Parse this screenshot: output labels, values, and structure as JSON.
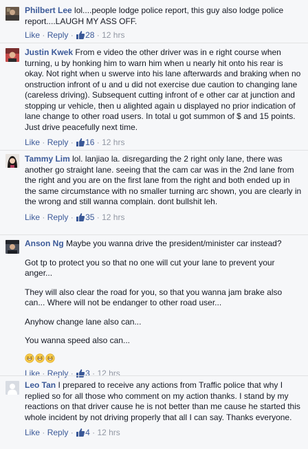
{
  "comments": [
    {
      "name": "Philbert Lee",
      "text": "lol....people lodge police report, this guy also lodge police report....LAUGH MY ASS OFF.",
      "like_label": "Like",
      "reply_label": "Reply",
      "likes": "28",
      "time": "12 hrs"
    },
    {
      "name": "Justin Kwek",
      "text": "From e video the other driver was in e right course when turning, u by honking him to warn him when u nearly hit onto his rear is okay. Not right when u swerve into his lane afterwards and braking when no onstruction infront of u and u did not exercise due caution to changing lane (careless driving). Subsequent cutting infront of e other car at junction and stopping ur vehicle, then u alighted again u displayed no prior indication of lane change to other road users. In total u got summon of $ and 15 points. Just drive peacefully next time.",
      "like_label": "Like",
      "reply_label": "Reply",
      "likes": "16",
      "time": "12 hrs"
    },
    {
      "name": "Tammy Lim",
      "text": "lol. lanjiao la. disregarding the 2 right only lane, there was another go straight lane. seeing that the cam car was in the 2nd lane from the right and you are on the first lane from the right and both ended up in the same circumstance with no smaller turning arc shown, you are clearly in the wrong and still wanna complain. dont bullshit leh.",
      "like_label": "Like",
      "reply_label": "Reply",
      "likes": "35",
      "time": "12 hrs"
    },
    {
      "name": "Anson Ng",
      "text": "Maybe you wanna drive the president/minister car instead?",
      "paragraphs": [
        "Got tp to protect you so that no one will cut your lane to prevent your anger...",
        "They will also clear the road for you, so that you wanna jam brake also can... Where will not be endanger to other road user...",
        "Anyhow change lane also can...",
        "You wanna speed also can..."
      ],
      "emojis": [
        "grinning-sweat-emoji",
        "grinning-sweat-emoji",
        "grinning-sweat-emoji"
      ],
      "like_label": "Like",
      "reply_label": "Reply",
      "likes": "3",
      "time": "12 hrs"
    },
    {
      "name": "Leo Tan",
      "text": "I prepared to receive any actions from Traffic police that why I replied so for all those who comment on my action thanks. I stand by my reactions on that driver cause he is not better than me cause he started this whole incident by not driving properly that all I can say. Thanks everyone.",
      "like_label": "Like",
      "reply_label": "Reply",
      "likes": "4",
      "time": "12 hrs"
    }
  ],
  "colors": {
    "name": "#3b5998",
    "meta": "#9197a3",
    "text": "#141823",
    "background": "#f6f7f9"
  }
}
